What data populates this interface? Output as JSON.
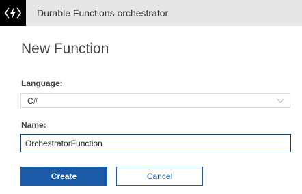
{
  "header": {
    "title": "Durable Functions orchestrator",
    "logo_icon": "azure-functions-lightning-icon"
  },
  "form": {
    "title": "New Function",
    "language": {
      "label": "Language:",
      "value": "C#"
    },
    "name": {
      "label": "Name:",
      "value": "OrchestratorFunction"
    }
  },
  "buttons": {
    "create": "Create",
    "cancel": "Cancel"
  },
  "colors": {
    "primary": "#1b5aa6",
    "header_bg": "#e6e6e6",
    "logo_bg": "#000000"
  }
}
